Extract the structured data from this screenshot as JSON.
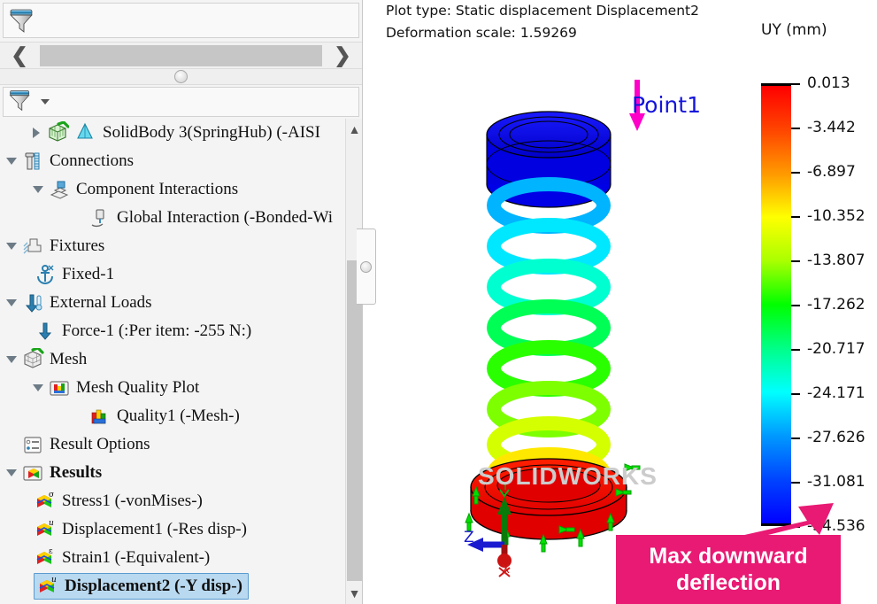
{
  "left_panel": {
    "filter_top": {
      "icon": "filter-funnel-icon"
    },
    "filter_bottom": {
      "icon": "filter-funnel-icon",
      "caret": "chevron-down-icon"
    },
    "hscroll": {
      "left_icon": "chevron-left-icon",
      "right_icon": "chevron-right-icon"
    },
    "vscroll": {
      "up_icon": "chevron-up-icon",
      "down_icon": "chevron-down-icon"
    },
    "tree": [
      {
        "label": "SolidBody 3(SpringHub) (-AISI",
        "indent": 1,
        "twisty": "right",
        "icon": "solid-body-icon",
        "bold": false,
        "selected": false
      },
      {
        "label": "Connections",
        "indent": 0,
        "twisty": "down",
        "icon": "connections-icon",
        "bold": false,
        "selected": false
      },
      {
        "label": "Component Interactions",
        "indent": 1,
        "twisty": "down",
        "icon": "component-interactions-icon",
        "bold": false,
        "selected": false
      },
      {
        "label": "Global Interaction (-Bonded-Wi",
        "indent": 2,
        "twisty": "none",
        "icon": "global-interaction-icon",
        "bold": false,
        "selected": false
      },
      {
        "label": "Fixtures",
        "indent": 0,
        "twisty": "down",
        "icon": "fixtures-icon",
        "bold": false,
        "selected": false
      },
      {
        "label": "Fixed-1",
        "indent": 1,
        "twisty": "none",
        "icon": "anchor-icon",
        "bold": false,
        "selected": false
      },
      {
        "label": "External Loads",
        "indent": 0,
        "twisty": "down",
        "icon": "external-loads-icon",
        "bold": false,
        "selected": false
      },
      {
        "label": "Force-1 (:Per item: -255 N:)",
        "indent": 1,
        "twisty": "none",
        "icon": "force-arrow-icon",
        "bold": false,
        "selected": false
      },
      {
        "label": "Mesh",
        "indent": 0,
        "twisty": "down",
        "icon": "mesh-icon",
        "bold": false,
        "selected": false
      },
      {
        "label": "Mesh Quality Plot",
        "indent": 1,
        "twisty": "down",
        "icon": "mesh-quality-folder-icon",
        "bold": false,
        "selected": false
      },
      {
        "label": "Quality1 (-Mesh-)",
        "indent": 2,
        "twisty": "none",
        "icon": "quality-plot-icon",
        "bold": false,
        "selected": false
      },
      {
        "label": "Result Options",
        "indent": 0,
        "twisty": "none",
        "icon": "result-options-icon",
        "bold": false,
        "selected": false
      },
      {
        "label": "Results",
        "indent": 0,
        "twisty": "down",
        "icon": "results-folder-icon",
        "bold": true,
        "selected": false
      },
      {
        "label": "Stress1 (-vonMises-)",
        "indent": 1,
        "twisty": "none",
        "icon": "stress-plot-icon",
        "bold": false,
        "selected": false
      },
      {
        "label": "Displacement1 (-Res disp-)",
        "indent": 1,
        "twisty": "none",
        "icon": "displacement-plot-icon",
        "bold": false,
        "selected": false
      },
      {
        "label": "Strain1 (-Equivalent-)",
        "indent": 1,
        "twisty": "none",
        "icon": "strain-plot-icon",
        "bold": false,
        "selected": false
      },
      {
        "label": "Displacement2 (-Y disp-)",
        "indent": 1,
        "twisty": "none",
        "icon": "displacement-plot-icon",
        "bold": true,
        "selected": true
      }
    ]
  },
  "graphics": {
    "header_line1": "Plot type: Static displacement Displacement2",
    "header_line2": "Deformation scale: 1.59269",
    "point_label": "Point1",
    "watermark": "SOLIDWORKS",
    "triad": {
      "x": "X",
      "y": "Y",
      "z": "Z"
    },
    "callout": {
      "line1": "Max downward",
      "line2": "deflection",
      "color": "#e81a73"
    }
  },
  "chart_data": {
    "type": "heatmap",
    "title": "UY (mm)",
    "ylabel": "UY (mm)",
    "legend_position": "right",
    "unit": "mm",
    "categories": [
      "0.013",
      "-3.442",
      "-6.897",
      "-10.352",
      "-13.807",
      "-17.262",
      "-20.717",
      "-24.171",
      "-27.626",
      "-31.081",
      "-34.536"
    ],
    "values": [
      0.013,
      -3.442,
      -6.897,
      -10.352,
      -13.807,
      -17.262,
      -20.717,
      -24.171,
      -27.626,
      -31.081,
      -34.536
    ],
    "ylim": [
      -34.536,
      0.013
    ],
    "colors": [
      "#ff0000",
      "#ff4400",
      "#ff9900",
      "#ffff00",
      "#aaff00",
      "#00ff00",
      "#00ff88",
      "#00ffff",
      "#0099ff",
      "#0044ff",
      "#0000ff"
    ],
    "plot_type": "Static displacement Displacement2",
    "deformation_scale": 1.59269,
    "max_value": 0.013,
    "min_value": -34.536,
    "annotation": "Max downward deflection"
  }
}
